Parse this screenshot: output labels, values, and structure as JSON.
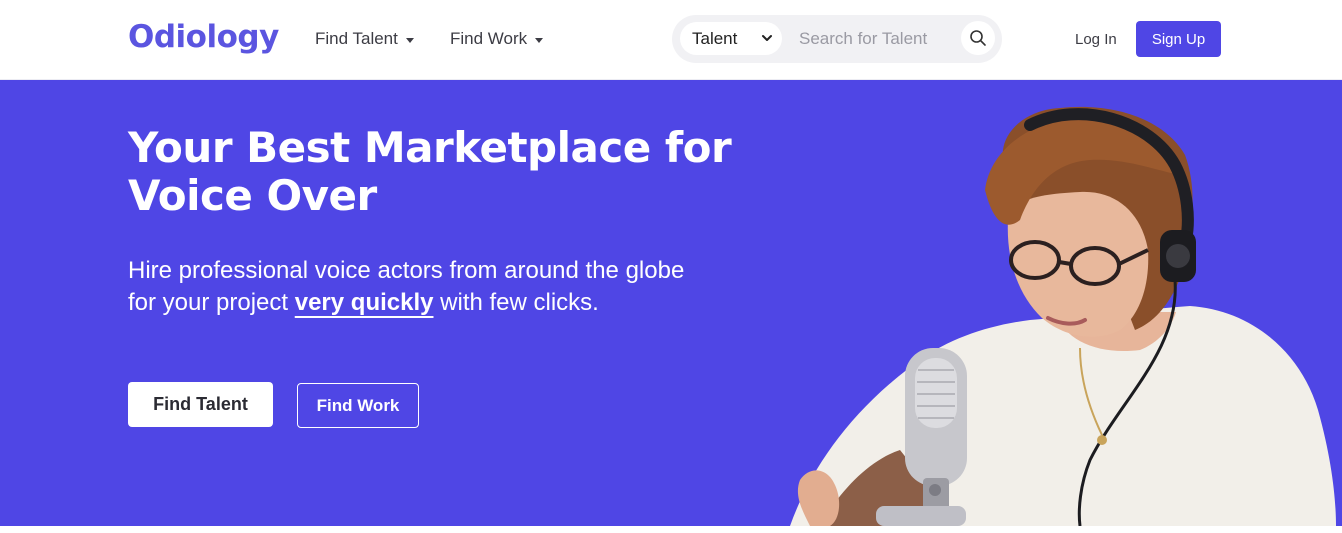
{
  "brand": {
    "name": "Odiology",
    "accent": "#4f46e5",
    "logo_color": "#5b55e0"
  },
  "nav": {
    "menu": [
      {
        "label": "Find Talent",
        "icon": "caret-down-icon"
      },
      {
        "label": "Find Work",
        "icon": "caret-down-icon"
      }
    ],
    "search": {
      "selected": "Talent",
      "placeholder": "Search for Talent",
      "icon": "search-icon"
    },
    "login_label": "Log In",
    "signup_label": "Sign Up"
  },
  "hero": {
    "headline": "Your Best Marketplace for Voice Over",
    "sub_before": "Hire professional voice actors from around the globe for your project ",
    "sub_emphasis": "very quickly",
    "sub_after": " with few clicks.",
    "primary_button": "Find Talent",
    "secondary_button": "Find Work",
    "image": "woman-with-headphones-and-microphone",
    "background": "#4f46e5"
  }
}
